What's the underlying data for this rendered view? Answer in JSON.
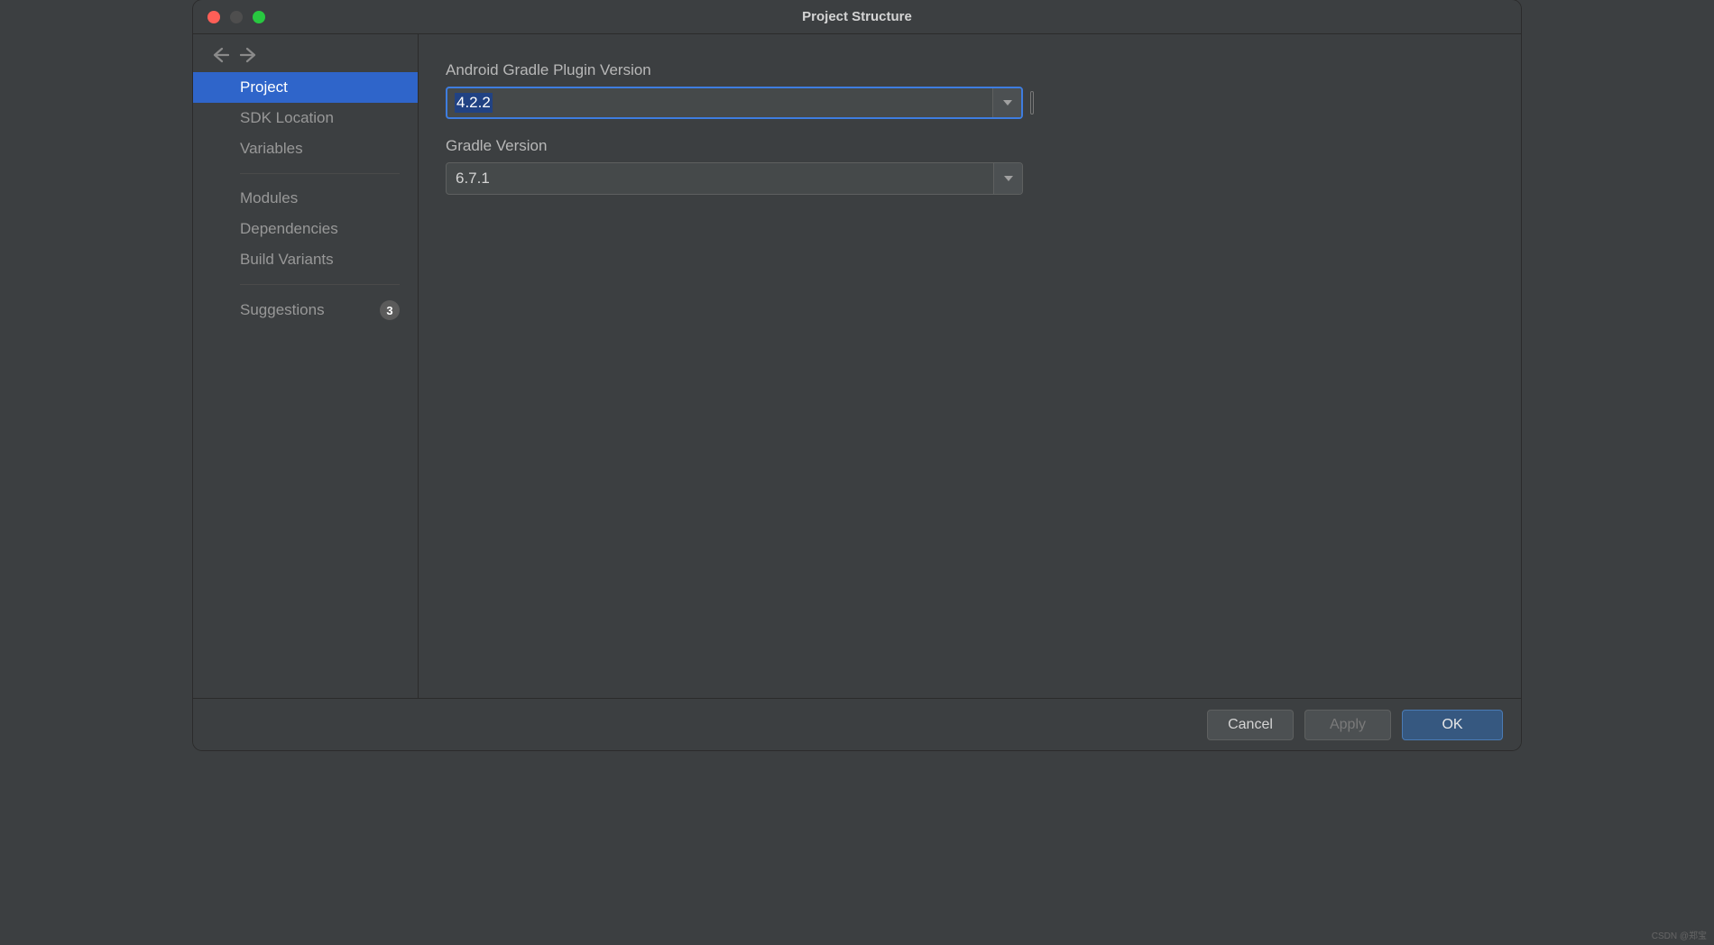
{
  "window": {
    "title": "Project Structure"
  },
  "sidebar": {
    "items": [
      {
        "label": "Project",
        "selected": true
      },
      {
        "label": "SDK Location"
      },
      {
        "label": "Variables"
      },
      {
        "divider": true
      },
      {
        "label": "Modules"
      },
      {
        "label": "Dependencies"
      },
      {
        "label": "Build Variants"
      },
      {
        "divider": true
      },
      {
        "label": "Suggestions",
        "badge": "3"
      }
    ]
  },
  "form": {
    "agp": {
      "label": "Android Gradle Plugin Version",
      "value": "4.2.2"
    },
    "gradle": {
      "label": "Gradle Version",
      "value": "6.7.1"
    }
  },
  "footer": {
    "cancel": "Cancel",
    "apply": "Apply",
    "ok": "OK"
  },
  "watermark": "CSDN @郑宝"
}
